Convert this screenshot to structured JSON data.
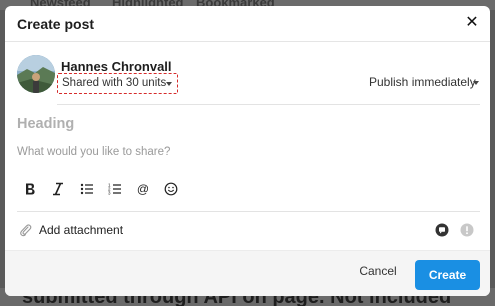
{
  "background": {
    "tabs": [
      "Newsfeed",
      "Highlighted",
      "Bookmarked"
    ],
    "footer_text": "submitted through API on page. Not included"
  },
  "modal": {
    "title": "Create post",
    "close_icon": "close-icon"
  },
  "author": {
    "name": "Hannes Chronvall",
    "share_label": "Shared with 30 units",
    "share_highlight_color": "#d62b2b"
  },
  "publish": {
    "label": "Publish immediately"
  },
  "editor": {
    "heading_placeholder": "Heading",
    "body_placeholder": "What would you like to share?"
  },
  "toolbar": {
    "items": [
      "bold-icon",
      "italic-icon",
      "bullet-list-icon",
      "numbered-list-icon",
      "mention-icon",
      "emoji-icon"
    ]
  },
  "attachment": {
    "label": "Add attachment",
    "icons": [
      "paperclip-icon",
      "comment-icon",
      "info-icon"
    ]
  },
  "actions": {
    "cancel_label": "Cancel",
    "create_label": "Create",
    "create_color": "#1a8fe3"
  }
}
